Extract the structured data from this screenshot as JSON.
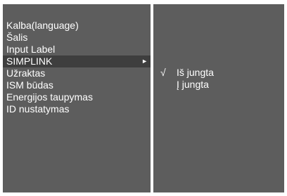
{
  "colors": {
    "panel_bg": "#5d5d5d",
    "selected_bg": "#3e3e3e",
    "text": "#ffffff",
    "border": "#ffffff"
  },
  "menu": {
    "items": [
      {
        "label": "Kalba(language)"
      },
      {
        "label": "Šalis"
      },
      {
        "label": "Input Label"
      },
      {
        "label": "SIMPLINK",
        "selected": true,
        "has_submenu": true
      },
      {
        "label": "Užraktas"
      },
      {
        "label": "ISM būdas"
      },
      {
        "label": "Energijos taupymas"
      },
      {
        "label": "ID nustatymas"
      }
    ],
    "submenu_arrow": "►"
  },
  "submenu": {
    "options": [
      {
        "label": "Iš jungta",
        "checked": true
      },
      {
        "label": "Į jungta",
        "checked": false
      }
    ],
    "check_glyph": "√"
  }
}
